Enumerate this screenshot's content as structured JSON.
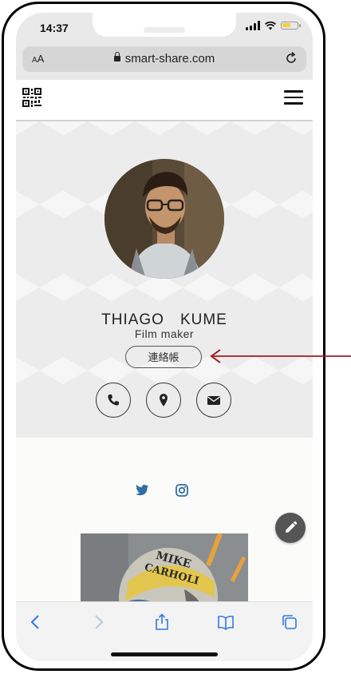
{
  "status": {
    "time": "14:37"
  },
  "browser": {
    "text_size_label_small": "A",
    "text_size_label": "A",
    "url": "smart-share.com"
  },
  "profile": {
    "name": "THIAGO　KUME",
    "role": "Film maker",
    "contact_book_label": "連絡帳"
  },
  "icons": {
    "qr": "qr-code-icon",
    "menu": "hamburger-menu-icon",
    "phone": "phone-icon",
    "location": "location-pin-icon",
    "email": "envelope-icon",
    "twitter": "twitter-icon",
    "instagram": "instagram-icon",
    "edit": "pencil-icon",
    "back": "chevron-left-icon",
    "forward": "chevron-right-icon",
    "share": "share-icon",
    "bookmarks": "book-icon",
    "tabs": "tabs-icon",
    "reload": "reload-icon",
    "lock": "lock-icon"
  },
  "colors": {
    "accent": "#2e6da4",
    "annotation_arrow": "#a01c1c",
    "fab": "#555555"
  }
}
